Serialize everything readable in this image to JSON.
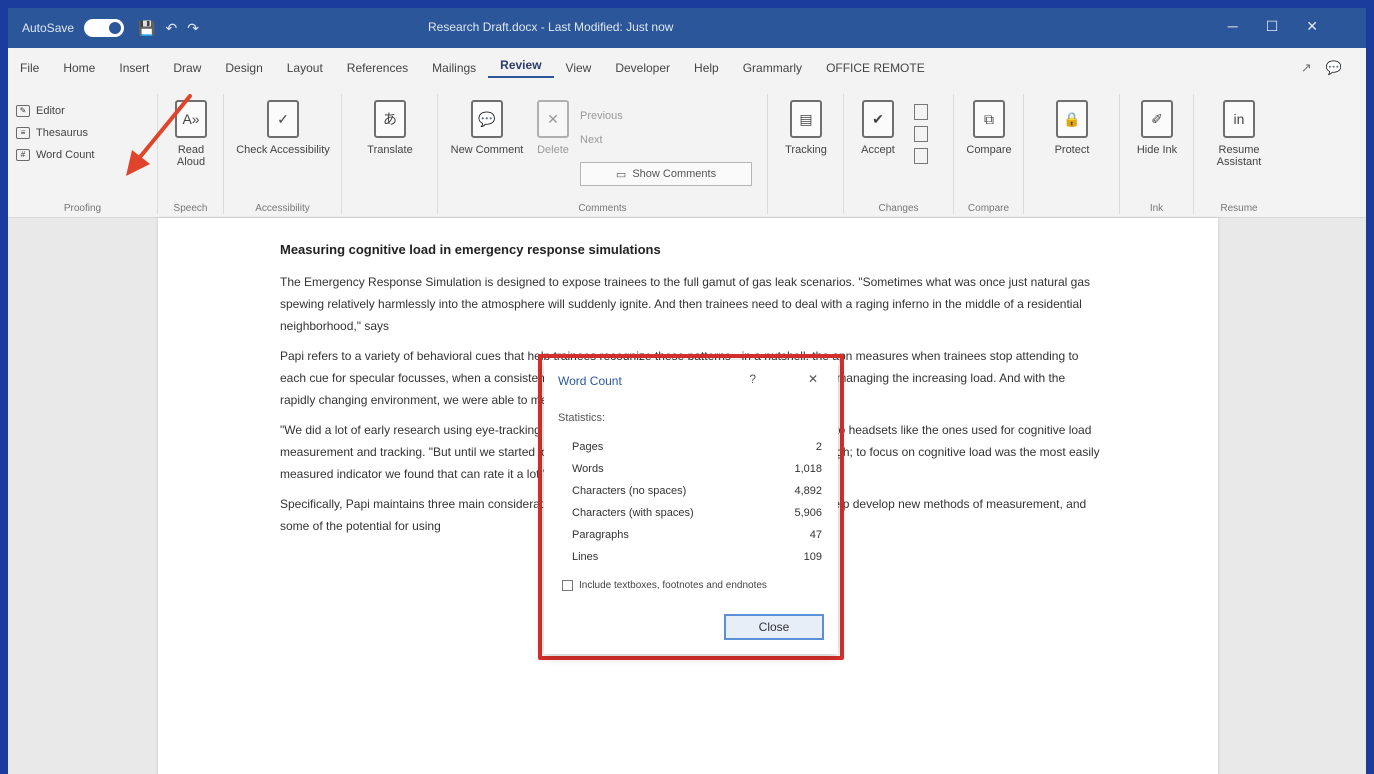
{
  "titlebar": {
    "autosave_label": "AutoSave",
    "autosave_state": "On",
    "document_title": "Research Draft.docx - Last Modified: Just now",
    "user_name": ""
  },
  "tabs": [
    "File",
    "Home",
    "Insert",
    "Draw",
    "Design",
    "Layout",
    "References",
    "Mailings",
    "Review",
    "View",
    "Developer",
    "Help",
    "Grammarly",
    "OFFICE REMOTE"
  ],
  "active_tab": "Review",
  "ribbon": {
    "proofing": {
      "items": [
        "Editor",
        "Thesaurus",
        "Word Count"
      ],
      "label": "Proofing"
    },
    "speech": {
      "button": "Read Aloud",
      "label": "Speech"
    },
    "accessibility": {
      "button": "Check Accessibility",
      "label": "Accessibility"
    },
    "language": {
      "button": "Translate"
    },
    "comments": {
      "new_comment": "New Comment",
      "delete": "Delete",
      "previous": "Previous",
      "next": "Next",
      "show_comments": "Show Comments",
      "label": "Comments"
    },
    "tracking": {
      "button": "Tracking"
    },
    "changes": {
      "button": "Accept",
      "label": "Changes"
    },
    "compare": {
      "button": "Compare",
      "label": "Compare"
    },
    "protect": {
      "button": "Protect"
    },
    "ink": {
      "button": "Hide Ink",
      "label": "Ink"
    },
    "resume": {
      "button": "Resume Assistant",
      "label": "Resume"
    }
  },
  "document": {
    "heading": "Measuring cognitive load in emergency response simulations",
    "paragraphs": [
      "The Emergency Response Simulation is designed to expose trainees to the full gamut of gas leak scenarios. \"Sometimes what was once just natural gas spewing relatively harmlessly into the atmosphere will suddenly ignite. And then trainees need to deal with a raging inferno in the middle of a residential neighborhood,\" says",
      "Papi refers to a variety of behavioral cues that help trainees recognize these patterns - in a nutshell, the apn measures when trainees stop attending to each cue for specular focusses, when a consistent gap a lost cone remains in the trainees thinking while managing the increasing load. And with the rapidly changing environment, we were able to measure that.",
      "\"We did a lot of early research using eye-tracking and similar technology like that,\" says Kashif, referring to headsets like the ones used for cognitive load measurement and tracking. \"But until we started looking at the findings in detail it wasn't compelling enough; to focus on cognitive load was the most easily measured indicator we found that can rate it a lot.\"",
      "Specifically, Papi maintains three main considerations. Papi discusses the possibilities for Omni-Lab to help develop new methods of measurement, and some of the potential for using"
    ]
  },
  "dialog": {
    "title": "Word Count",
    "help": "?",
    "close_x": "✕",
    "section": "Statistics:",
    "stats": [
      {
        "label": "Pages",
        "value": "2"
      },
      {
        "label": "Words",
        "value": "1,018"
      },
      {
        "label": "Characters (no spaces)",
        "value": "4,892"
      },
      {
        "label": "Characters (with spaces)",
        "value": "5,906"
      },
      {
        "label": "Paragraphs",
        "value": "47"
      },
      {
        "label": "Lines",
        "value": "109"
      }
    ],
    "checkbox_label": "Include textboxes, footnotes and endnotes",
    "close_button": "Close"
  },
  "colors": {
    "brand": "#2b579a",
    "highlight": "#d9302b",
    "frame": "#1a3a9c"
  }
}
